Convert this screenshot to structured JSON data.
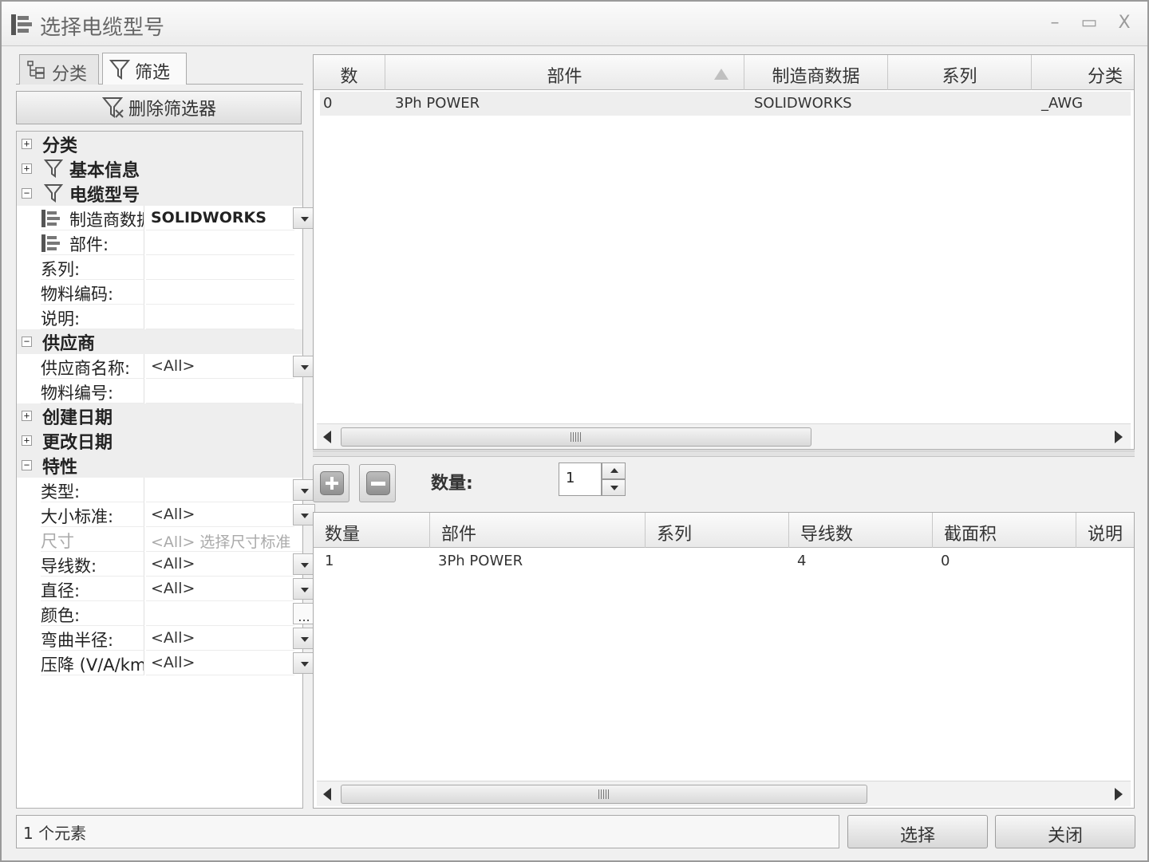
{
  "window": {
    "title": "选择电缆型号",
    "controls": {
      "minimize": "–",
      "maximize": "▭",
      "close": "X"
    }
  },
  "left_panel": {
    "tabs": [
      {
        "label": "分类",
        "icon": "tree-icon",
        "active": false
      },
      {
        "label": "筛选",
        "icon": "funnel-icon",
        "active": true
      }
    ],
    "delete_filter_button": "删除筛选器",
    "tree": {
      "category": {
        "label": "分类",
        "expander": "+"
      },
      "basic_info": {
        "label": "基本信息",
        "expander": "+"
      },
      "cable_model": {
        "label": "电缆型号",
        "expander": "−",
        "properties": {
          "manufacturer": {
            "name": "制造商数据:",
            "value": "SOLIDWORKS"
          },
          "part": {
            "name": "部件:",
            "value": ""
          },
          "series": {
            "name": "系列:",
            "value": ""
          },
          "material_code": {
            "name": "物料编码:",
            "value": ""
          },
          "description": {
            "name": "说明:",
            "value": ""
          }
        }
      },
      "supplier": {
        "label": "供应商",
        "expander": "−",
        "properties": {
          "supplier_name": {
            "name": "供应商名称:",
            "value": "<All>"
          },
          "material_number": {
            "name": "物料编号:",
            "value": ""
          }
        }
      },
      "created_date": {
        "label": "创建日期",
        "expander": "+"
      },
      "modified_date": {
        "label": "更改日期",
        "expander": "+"
      },
      "characteristics": {
        "label": "特性",
        "expander": "−",
        "properties": {
          "type": {
            "name": "类型:",
            "value": ""
          },
          "size_standard": {
            "name": "大小标准:",
            "value": "<All>"
          },
          "size": {
            "name": "尺寸",
            "value": "<All> 选择尺寸标准"
          },
          "conductor_count": {
            "name": "导线数:",
            "value": "<All>"
          },
          "diameter": {
            "name": "直径:",
            "value": "<All>"
          },
          "color": {
            "name": "颜色:",
            "value": "",
            "button": "..."
          },
          "bend_radius": {
            "name": "弯曲半径:",
            "value": "<All>"
          },
          "voltage_drop": {
            "name": "压降 (V/A/km):",
            "value": "<All>"
          }
        }
      }
    }
  },
  "results_grid": {
    "columns": [
      "数",
      "部件",
      "制造商数据",
      "系列",
      "分类"
    ],
    "rows": [
      {
        "num": "0",
        "part": "3Ph POWER",
        "manufacturer": "SOLIDWORKS",
        "series": "",
        "category": "_AWG"
      }
    ]
  },
  "quantity": {
    "label": "数量:",
    "value": "1"
  },
  "selection_grid": {
    "columns": [
      "数量",
      "部件",
      "系列",
      "导线数",
      "截面积",
      "说明"
    ],
    "rows": [
      {
        "qty": "1",
        "part": "3Ph POWER",
        "series": "",
        "conductors": "4",
        "cross_section": "0",
        "description": ""
      }
    ]
  },
  "status": {
    "text": "1 个元素"
  },
  "buttons": {
    "select": "选择",
    "close": "关闭"
  },
  "colors": {
    "window_bg": "#f0f0f0",
    "group_row_bg": "#eeeeee",
    "selected_row_bg": "#eeeeee",
    "border": "#aaaaaa"
  }
}
